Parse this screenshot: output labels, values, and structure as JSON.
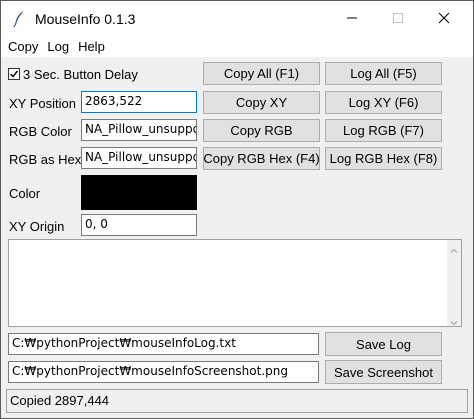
{
  "window": {
    "title": "MouseInfo 0.1.3",
    "icon": "feather-icon"
  },
  "menu": {
    "items": [
      "Copy",
      "Log",
      "Help"
    ]
  },
  "delay": {
    "checked": true,
    "label": "3 Sec. Button Delay"
  },
  "buttons": {
    "copy_all": "Copy All (F1)",
    "log_all": "Log All (F5)",
    "copy_xy": "Copy XY",
    "log_xy": "Log XY (F6)",
    "copy_rgb": "Copy RGB",
    "log_rgb": "Log RGB (F7)",
    "copy_rgb_hex": "Copy RGB Hex (F4)",
    "log_rgb_hex": "Log RGB Hex (F8)",
    "save_log": "Save Log",
    "save_screenshot": "Save Screenshot"
  },
  "fields": {
    "xy_position": {
      "label": "XY Position",
      "value": "2863,522"
    },
    "rgb_color": {
      "label": "RGB Color",
      "value": "NA_Pillow_unsuppo"
    },
    "rgb_hex": {
      "label": "RGB as Hex",
      "value": "NA_Pillow_unsuppo"
    },
    "color": {
      "label": "Color",
      "swatch": "#000000"
    },
    "xy_origin": {
      "label": "XY Origin",
      "value": "0, 0"
    }
  },
  "paths": {
    "log_file": "C:₩pythonProject₩mouseInfoLog.txt",
    "screenshot_file": "C:₩pythonProject₩mouseInfoScreenshot.png"
  },
  "status": {
    "text": "Copied 2897,444"
  },
  "colors": {
    "focus_border": "#0078d7",
    "button_bg": "#e1e1e1",
    "window_bg": "#f0f0f0"
  }
}
